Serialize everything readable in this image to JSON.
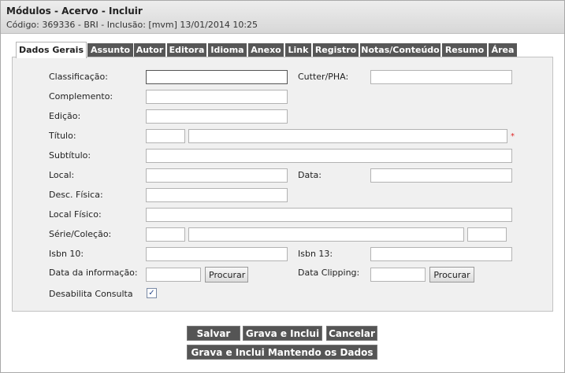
{
  "header": {
    "title": "Módulos - Acervo - Incluir",
    "subtitle": "Código: 369336 - BRI - Inclusão: [mvm] 13/01/2014 10:25"
  },
  "tabs": [
    "Dados Gerais",
    "Assunto",
    "Autor",
    "Editora",
    "Idioma",
    "Anexo",
    "Link",
    "Registro",
    "Notas/Conteúdo",
    "Resumo",
    "Área"
  ],
  "active_tab": "Dados Gerais",
  "form": {
    "classificacao": "Classificação:",
    "cutter": "Cutter/PHA:",
    "complemento": "Complemento:",
    "edicao": "Edição:",
    "titulo": "Título:",
    "required_mark": "*",
    "subtitulo": "Subtítulo:",
    "local": "Local:",
    "data": "Data:",
    "desc_fisica": "Desc. Física:",
    "local_fisico": "Local Físico:",
    "serie_colecao": "Série/Coleção:",
    "isbn10": "Isbn 10:",
    "isbn13": "Isbn 13:",
    "data_informacao": "Data da informação:",
    "data_clipping": "Data Clipping:",
    "procurar": "Procurar",
    "desabilita_consulta": "Desabilita Consulta",
    "desabilita_checked": true
  },
  "actions": {
    "salvar": "Salvar",
    "grava_inclui": "Grava e Inclui",
    "cancelar": "Cancelar",
    "grava_inclui_mantendo": "Grava e Inclui Mantendo os Dados"
  },
  "colors": {
    "tab_bg": "#575757",
    "button_bg": "#555555",
    "panel_bg": "#f0f0f0",
    "required": "#dd2222"
  }
}
